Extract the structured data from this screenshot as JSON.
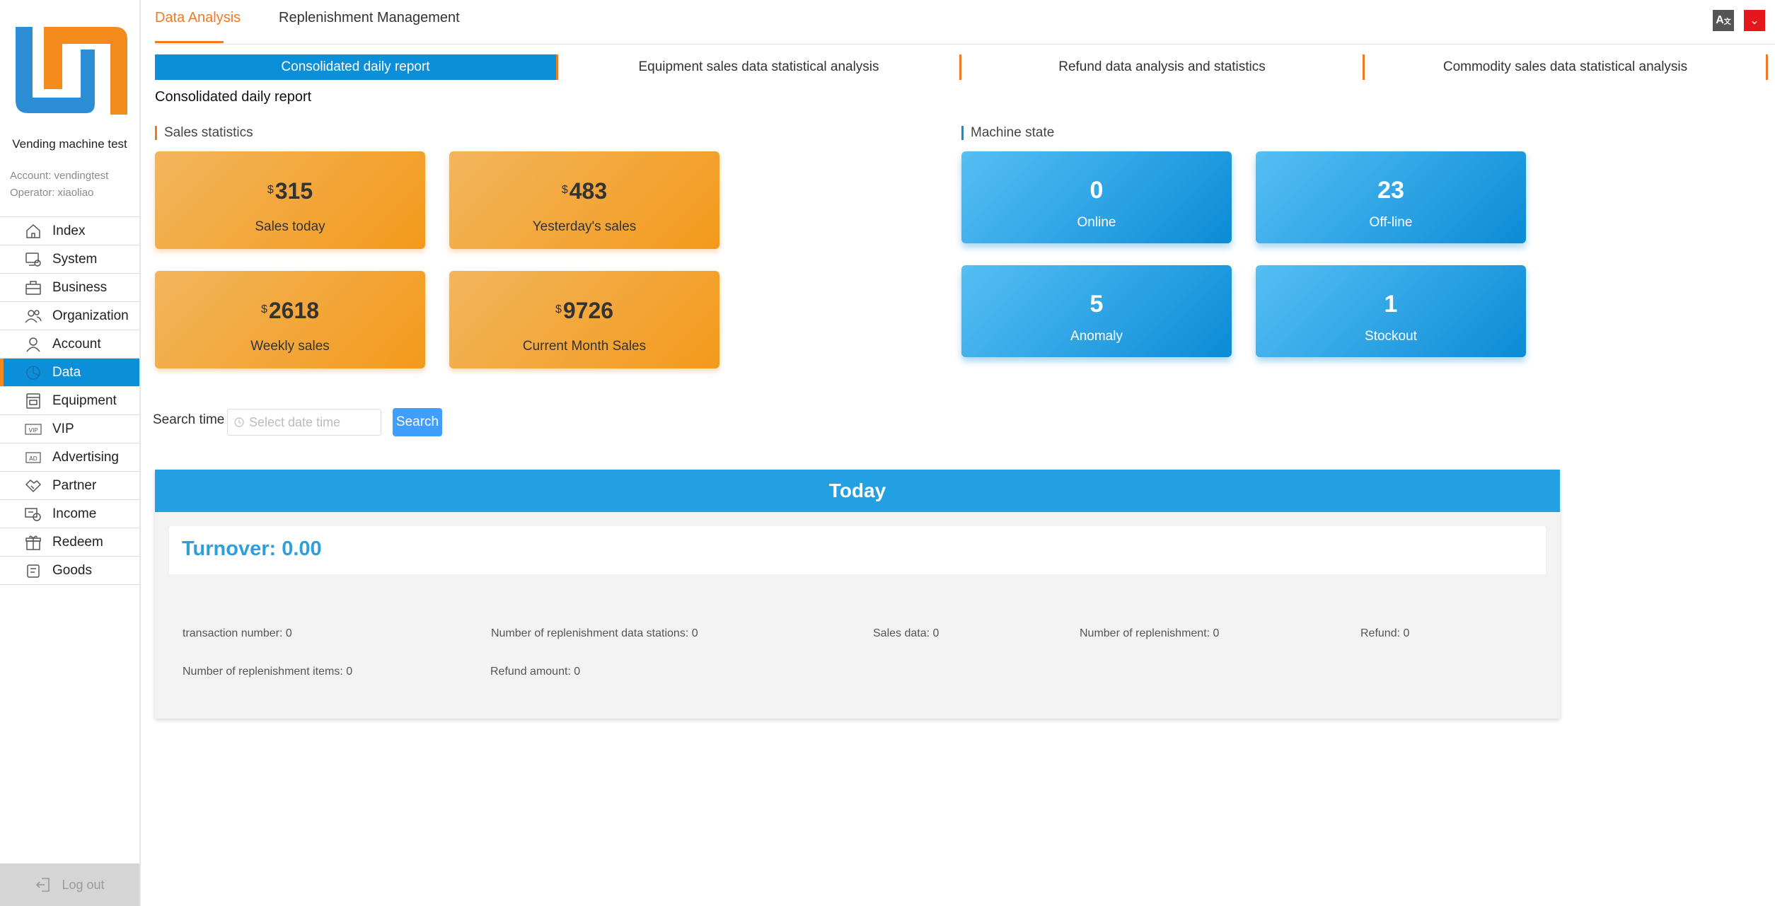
{
  "brand": {
    "name": "Vending machine test",
    "account": "Account:  vendingtest",
    "operator": "Operator:  xiaoliao"
  },
  "colors": {
    "accent_orange": "#f07a21",
    "accent_blue": "#0b8fd8",
    "panel_blue": "#22a0e3",
    "search_blue": "#409eff"
  },
  "sidebar": {
    "items": [
      {
        "label": "Index",
        "icon": "home-icon"
      },
      {
        "label": "System",
        "icon": "system-icon"
      },
      {
        "label": "Business",
        "icon": "briefcase-icon"
      },
      {
        "label": "Organization",
        "icon": "users-icon"
      },
      {
        "label": "Account",
        "icon": "user-icon"
      },
      {
        "label": "Data",
        "icon": "pie-chart-icon",
        "active": true
      },
      {
        "label": "Equipment",
        "icon": "machine-icon"
      },
      {
        "label": "VIP",
        "icon": "vip-icon"
      },
      {
        "label": "Advertising",
        "icon": "ad-icon"
      },
      {
        "label": "Partner",
        "icon": "handshake-icon"
      },
      {
        "label": "Income",
        "icon": "income-icon"
      },
      {
        "label": "Redeem",
        "icon": "gift-icon"
      },
      {
        "label": "Goods",
        "icon": "goods-icon"
      }
    ],
    "logout": "Log out"
  },
  "top_tabs": [
    "Data  Analysis",
    "Replenishment  Management"
  ],
  "sub_tabs": [
    "Consolidated daily report",
    "Equipment sales data statistical analysis",
    "Refund data analysis and statistics",
    "Commodity sales data statistical analysis"
  ],
  "page_title": "Consolidated daily report",
  "sales_statistics": {
    "title": "Sales statistics",
    "currency": "$",
    "cards": [
      {
        "value": "315",
        "label": "Sales today"
      },
      {
        "value": "483",
        "label": "Yesterday's sales"
      },
      {
        "value": "2618",
        "label": "Weekly sales"
      },
      {
        "value": "9726",
        "label": "Current Month Sales"
      }
    ]
  },
  "machine_state": {
    "title": "Machine state",
    "cards": [
      {
        "value": "0",
        "label": "Online"
      },
      {
        "value": "23",
        "label": "Off-line"
      },
      {
        "value": "5",
        "label": "Anomaly"
      },
      {
        "value": "1",
        "label": "Stockout"
      }
    ]
  },
  "search": {
    "label": "Search time",
    "placeholder": "Select date time",
    "button": "Search"
  },
  "today": {
    "title": "Today",
    "turnover": "Turnover:  0.00",
    "stats": [
      "transaction number:  0",
      "Number of replenishment data stations:  0",
      "Sales data:  0",
      "Number of replenishment:  0",
      "Refund:  0",
      "Number of replenishment items:  0",
      "Refund amount:  0"
    ]
  }
}
